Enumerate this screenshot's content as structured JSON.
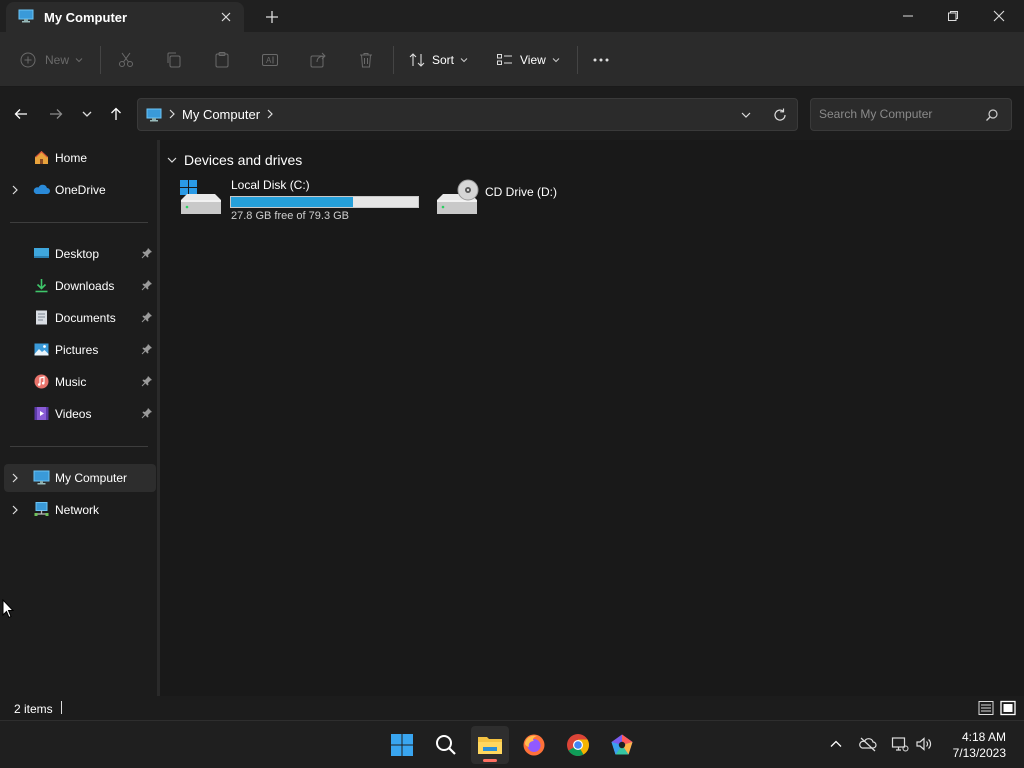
{
  "window": {
    "tab_title": "My Computer",
    "controls": [
      "minimize-icon",
      "restore-icon",
      "close-icon"
    ]
  },
  "toolbar": {
    "new_label": "New",
    "sort_label": "Sort",
    "view_label": "View",
    "disabled_icons": [
      "cut-icon",
      "copy-icon",
      "paste-icon",
      "rename-icon",
      "share-icon",
      "delete-icon"
    ]
  },
  "address": {
    "crumb": "My Computer"
  },
  "search": {
    "placeholder": "Search My Computer"
  },
  "sidebar": {
    "items": [
      {
        "label": "Home",
        "icon": "home-icon"
      },
      {
        "label": "OneDrive",
        "icon": "onedrive-icon"
      },
      {
        "label": "Desktop",
        "icon": "desktop-icon",
        "pinned": true
      },
      {
        "label": "Downloads",
        "icon": "downloads-icon",
        "pinned": true
      },
      {
        "label": "Documents",
        "icon": "documents-icon",
        "pinned": true
      },
      {
        "label": "Pictures",
        "icon": "pictures-icon",
        "pinned": true
      },
      {
        "label": "Music",
        "icon": "music-icon",
        "pinned": true
      },
      {
        "label": "Videos",
        "icon": "videos-icon",
        "pinned": true
      },
      {
        "label": "My Computer",
        "icon": "computer-icon",
        "selected": true
      },
      {
        "label": "Network",
        "icon": "network-icon"
      }
    ]
  },
  "content": {
    "group_label": "Devices and drives",
    "drives": [
      {
        "name": "Local Disk (C:)",
        "free_text": "27.8 GB free of 79.3 GB",
        "used_fraction": 0.65,
        "bar_color": "#26a0da"
      },
      {
        "name": "CD Drive (D:)"
      }
    ]
  },
  "status": {
    "items_text": "2 items"
  },
  "taskbar": {
    "apps": [
      "windows-start-icon",
      "search-icon",
      "file-explorer-icon",
      "firefox-icon",
      "chrome-icon",
      "pentagon-app-icon"
    ],
    "time": "4:18 AM",
    "date": "7/13/2023"
  },
  "colors": {
    "accent": "#26a0da",
    "background": "#1c1c1c",
    "toolbar": "#2b2b2b"
  }
}
